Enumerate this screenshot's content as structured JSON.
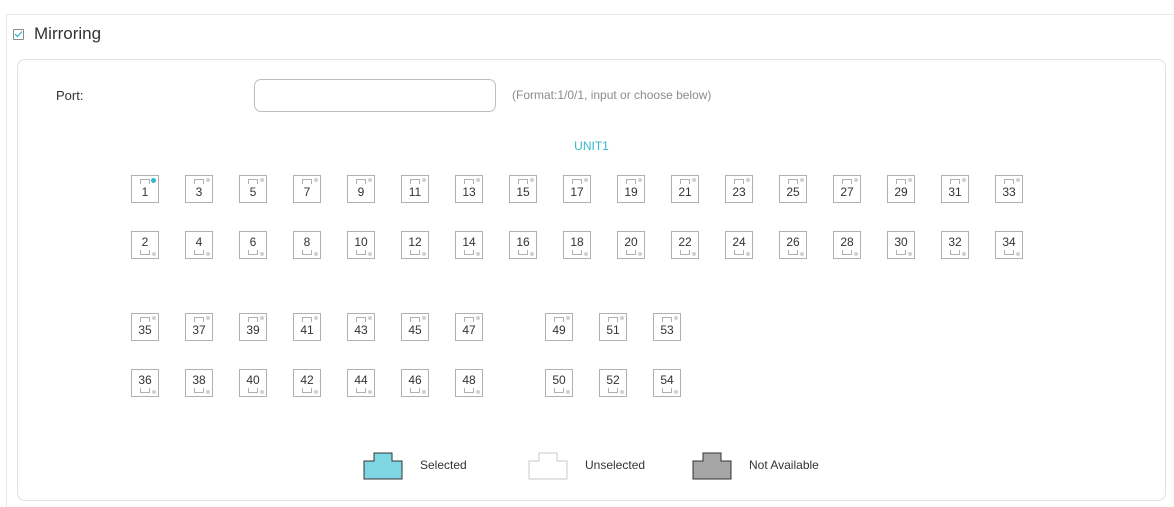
{
  "section": {
    "title": "Mirroring",
    "checked": true
  },
  "port_field": {
    "label": "Port:",
    "value": "",
    "placeholder": "",
    "hint": "(Format:1/0/1, input or choose below)"
  },
  "unit": {
    "label": "UNIT1"
  },
  "ports": {
    "group1_top": [
      "1",
      "3",
      "5",
      "7",
      "9",
      "11",
      "13",
      "15",
      "17",
      "19",
      "21",
      "23",
      "25",
      "27",
      "29",
      "31",
      "33"
    ],
    "group1_bottom": [
      "2",
      "4",
      "6",
      "8",
      "10",
      "12",
      "14",
      "16",
      "18",
      "20",
      "22",
      "24",
      "26",
      "28",
      "30",
      "32",
      "34"
    ],
    "group2_top": [
      "35",
      "37",
      "39",
      "41",
      "43",
      "45",
      "47"
    ],
    "group2_bottom": [
      "36",
      "38",
      "40",
      "42",
      "44",
      "46",
      "48"
    ],
    "group3_top": [
      "49",
      "51",
      "53"
    ],
    "group3_bottom": [
      "50",
      "52",
      "54"
    ],
    "active_led_port": "1"
  },
  "legend": {
    "selected": {
      "label": "Selected",
      "color": "#7fd6e3"
    },
    "unselected": {
      "label": "Unselected",
      "color": "#ffffff"
    },
    "not_available": {
      "label": "Not Available",
      "color": "#a6a6a6"
    }
  },
  "colors": {
    "accent": "#35b8c9",
    "border": "#b0b0b0"
  }
}
